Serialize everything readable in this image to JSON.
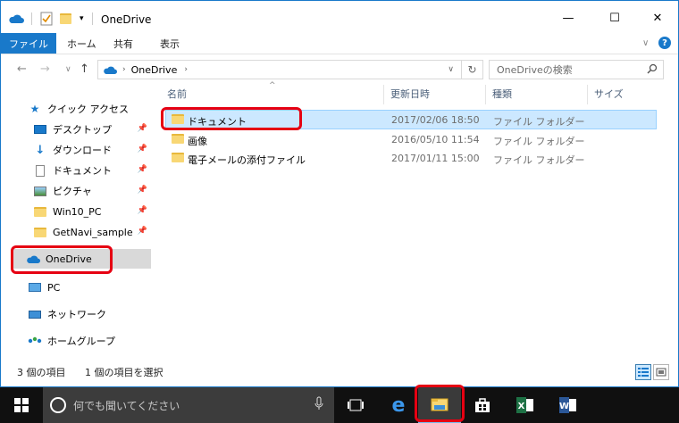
{
  "window": {
    "title": "OneDrive",
    "quick_access_toolbar": [
      "onedrive-icon",
      "properties-icon",
      "new-folder-icon",
      "customize-arrow"
    ],
    "controls": {
      "minimize": "—",
      "maximize": "☐",
      "close": "✕"
    }
  },
  "ribbon": {
    "file_tab": "ファイル",
    "tabs": [
      "ホーム",
      "共有",
      "表示"
    ]
  },
  "address_bar": {
    "breadcrumb": [
      "OneDrive"
    ],
    "search_placeholder": "OneDriveの検索"
  },
  "nav_pane": {
    "quick_access": "クイック アクセス",
    "pinned": [
      {
        "label": "デスクトップ",
        "icon": "desktop-icon"
      },
      {
        "label": "ダウンロード",
        "icon": "download-icon"
      },
      {
        "label": "ドキュメント",
        "icon": "document-icon"
      },
      {
        "label": "ピクチャ",
        "icon": "picture-icon"
      },
      {
        "label": "Win10_PC",
        "icon": "folder-icon"
      },
      {
        "label": "GetNavi_sample",
        "icon": "folder-icon"
      }
    ],
    "onedrive": "OneDrive",
    "pc": "PC",
    "network": "ネットワーク",
    "homegroup": "ホームグループ"
  },
  "file_list": {
    "columns": [
      "名前",
      "更新日時",
      "種類",
      "サイズ"
    ],
    "rows": [
      {
        "name": "ドキュメント",
        "modified": "2017/02/06 18:50",
        "type": "ファイル フォルダー",
        "size": ""
      },
      {
        "name": "画像",
        "modified": "2016/05/10 11:54",
        "type": "ファイル フォルダー",
        "size": ""
      },
      {
        "name": "電子メールの添付ファイル",
        "modified": "2017/01/11 15:00",
        "type": "ファイル フォルダー",
        "size": ""
      }
    ]
  },
  "status_bar": {
    "item_count": "3 個の項目",
    "selected_count": "1 個の項目を選択"
  },
  "taskbar": {
    "search_placeholder": "何でも聞いてください"
  },
  "colors": {
    "accent": "#1979ca",
    "selection": "#cce8ff",
    "highlight": "#e60012",
    "taskbar": "#101010"
  }
}
